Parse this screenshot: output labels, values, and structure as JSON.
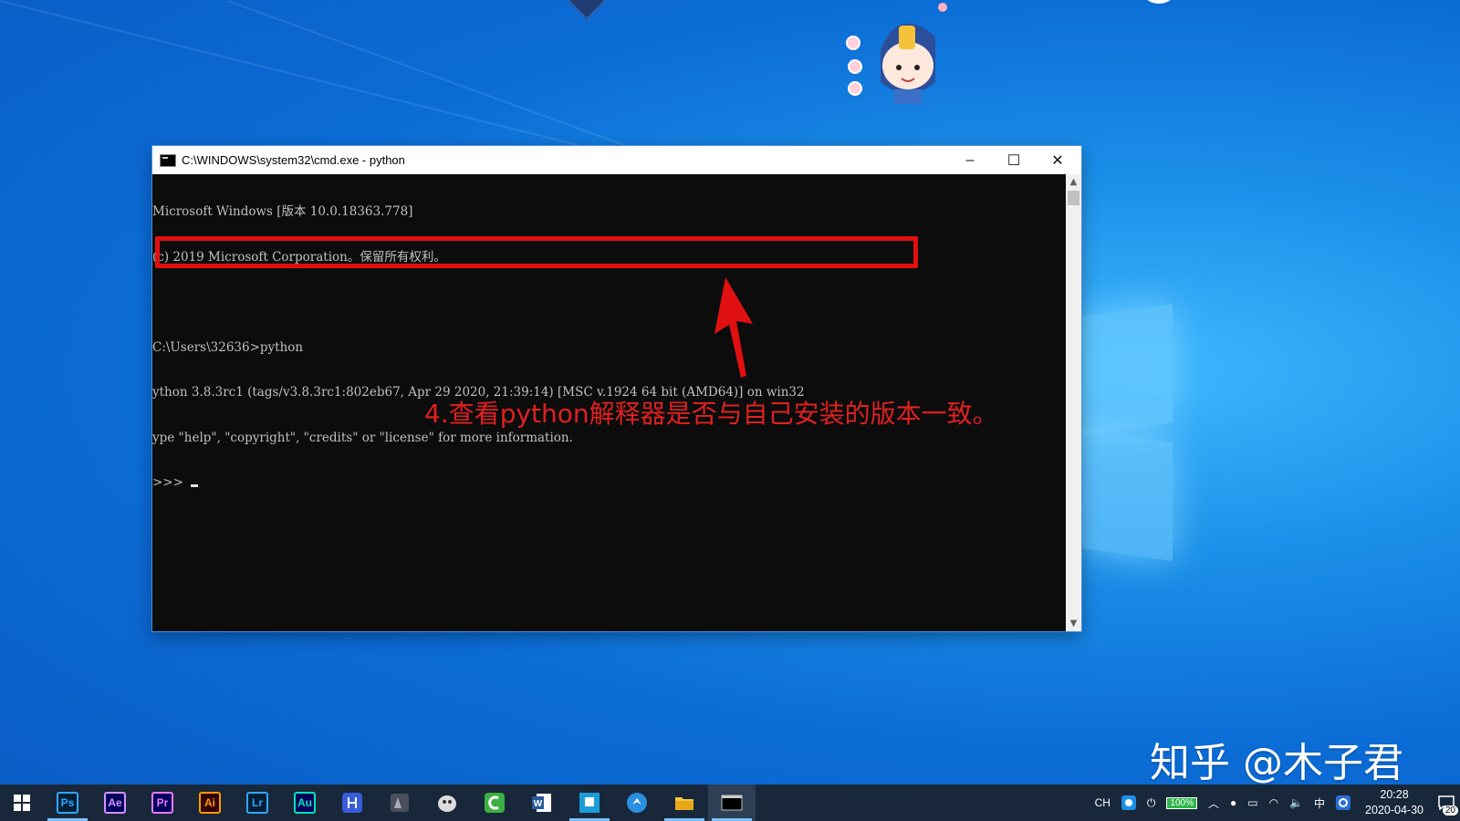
{
  "window": {
    "title": "C:\\WINDOWS\\system32\\cmd.exe - python",
    "minimize": "–",
    "maximize": "☐",
    "close": "✕"
  },
  "console": {
    "lines": [
      "Microsoft Windows [版本 10.0.18363.778]",
      "(c) 2019 Microsoft Corporation。保留所有权利。",
      "",
      "C:\\Users\\32636>python",
      "ython 3.8.3rc1 (tags/v3.8.3rc1:802eb67, Apr 29 2020, 21:39:14) [MSC v.1924 64 bit (AMD64)] on win32",
      "ype \"help\", \"copyright\", \"credits\" or \"license\" for more information.",
      ">>> "
    ]
  },
  "annotation": {
    "text": "4.查看python解释器是否与自己安装的版本一致。",
    "color": "#e02020"
  },
  "watermark": "知乎 @木子君",
  "taskbar": {
    "apps": [
      {
        "name": "photoshop",
        "label": "Ps",
        "color": "#31a8ff",
        "bg": "#001e36",
        "active": true
      },
      {
        "name": "after-effects",
        "label": "Ae",
        "color": "#d291ff",
        "bg": "#00005b",
        "active": false
      },
      {
        "name": "premiere",
        "label": "Pr",
        "color": "#ea77ff",
        "bg": "#00005b",
        "active": false
      },
      {
        "name": "illustrator",
        "label": "Ai",
        "color": "#ff9a00",
        "bg": "#330000",
        "active": false
      },
      {
        "name": "lightroom",
        "label": "Lr",
        "color": "#31a8ff",
        "bg": "#001e36",
        "active": false
      },
      {
        "name": "audition",
        "label": "Au",
        "color": "#00e4bb",
        "bg": "#00005b",
        "active": false
      }
    ],
    "tray": {
      "ime_ch": "CH",
      "battery": "100%",
      "ime_zh": "中",
      "time": "20:28",
      "date": "2020-04-30",
      "notifications": "20"
    }
  }
}
